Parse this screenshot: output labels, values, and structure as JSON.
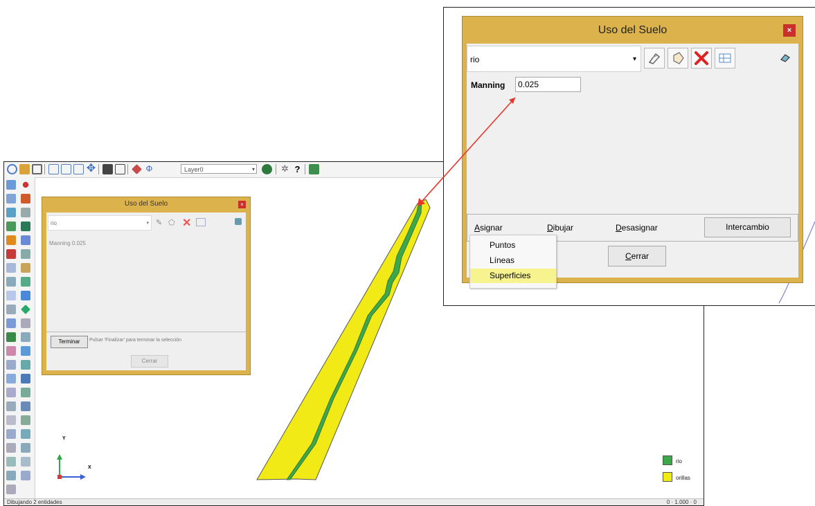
{
  "app": {
    "layer_select": "Layer0",
    "status_left": "Dibujando 2 entidades",
    "status_right": "0 · 1.000 · 0"
  },
  "small_dialog": {
    "title": "Uso del Suelo",
    "close": "×",
    "select_value": "rio",
    "manning_text": "Manning 0.025",
    "terminar_label": "Terminar",
    "terminar_message": "Pulsar 'Finalizar' para terminar la selección",
    "cerrar_label": "Cerrar"
  },
  "big_dialog": {
    "title": "Uso del Suelo",
    "close": "×",
    "combo_value": "rio",
    "manning_label": "Manning",
    "manning_value": "0.025",
    "tabs": [
      {
        "label": "Asignar",
        "mnemonic": "A",
        "rest": "signar"
      },
      {
        "label": "Dibujar",
        "mnemonic": "D",
        "rest": "ibujar"
      },
      {
        "label": "Desasignar",
        "mnemonic": "D",
        "rest": "esasignar"
      }
    ],
    "intercambio_label": "Intercambio",
    "cerrar_mnemonic": "C",
    "cerrar_rest": "errar",
    "menu_items": [
      "Puntos",
      "Líneas",
      "Superficies"
    ],
    "menu_selected": "Superficies"
  },
  "legend": {
    "items": [
      {
        "label": "rio",
        "color": "#3da84a"
      },
      {
        "label": "orillas",
        "color": "#f2ea17"
      }
    ]
  },
  "axes": {
    "x_label": "X",
    "y_label": "Y"
  },
  "colors": {
    "dialog_frame": "#dcb24c",
    "close_red": "#c9302c",
    "river_green": "#3da84a",
    "bank_yellow": "#f2ea17",
    "arrow_red": "#e8352b"
  }
}
